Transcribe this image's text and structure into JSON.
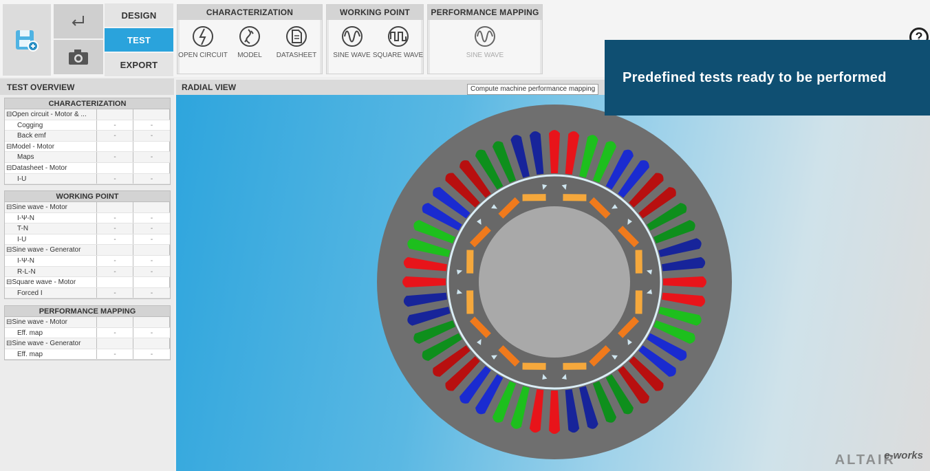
{
  "ribbon": {
    "nav": {
      "design": "DESIGN",
      "test": "TEST",
      "export": "EXPORT"
    },
    "groups": [
      {
        "title": "CHARACTERIZATION",
        "tools": [
          "OPEN CIRCUIT",
          "MODEL",
          "DATASHEET"
        ]
      },
      {
        "title": "WORKING POINT",
        "tools": [
          "SINE WAVE",
          "SQUARE WAVE"
        ]
      },
      {
        "title": "PERFORMANCE MAPPING",
        "tools": [
          "SINE WAVE"
        ]
      }
    ],
    "help": "?"
  },
  "banner": {
    "text": "Predefined tests ready to be performed"
  },
  "tooltip": {
    "text": "Compute machine performance mapping"
  },
  "left_panel": {
    "title": "TEST OVERVIEW",
    "sections": [
      {
        "title": "CHARACTERIZATION",
        "rows": [
          {
            "label": "⊟Open circuit - Motor & ...",
            "a": "",
            "b": "",
            "type": "group"
          },
          {
            "label": "Cogging",
            "a": "-",
            "b": "-",
            "type": "sub"
          },
          {
            "label": "Back emf",
            "a": "-",
            "b": "-",
            "type": "sub"
          },
          {
            "label": "⊟Model - Motor",
            "a": "",
            "b": "",
            "type": "group"
          },
          {
            "label": "Maps",
            "a": "-",
            "b": "-",
            "type": "sub"
          },
          {
            "label": "⊟Datasheet - Motor",
            "a": "",
            "b": "",
            "type": "group"
          },
          {
            "label": "I-U",
            "a": "-",
            "b": "-",
            "type": "sub"
          }
        ]
      },
      {
        "title": "WORKING POINT",
        "rows": [
          {
            "label": "⊟Sine wave - Motor",
            "a": "",
            "b": "",
            "type": "group"
          },
          {
            "label": "I-Ψ-N",
            "a": "-",
            "b": "-",
            "type": "sub"
          },
          {
            "label": "T-N",
            "a": "-",
            "b": "-",
            "type": "sub"
          },
          {
            "label": "I-U",
            "a": "-",
            "b": "-",
            "type": "sub"
          },
          {
            "label": "⊟Sine wave - Generator",
            "a": "",
            "b": "",
            "type": "group"
          },
          {
            "label": "I-Ψ-N",
            "a": "-",
            "b": "-",
            "type": "sub"
          },
          {
            "label": "R-L-N",
            "a": "-",
            "b": "-",
            "type": "sub"
          },
          {
            "label": "⊟Square wave - Motor",
            "a": "",
            "b": "",
            "type": "group"
          },
          {
            "label": "Forced I",
            "a": "-",
            "b": "-",
            "type": "sub"
          }
        ]
      },
      {
        "title": "PERFORMANCE MAPPING",
        "rows": [
          {
            "label": "⊟Sine wave - Motor",
            "a": "",
            "b": "",
            "type": "group"
          },
          {
            "label": "Eff. map",
            "a": "-",
            "b": "-",
            "type": "sub"
          },
          {
            "label": "⊟Sine wave - Generator",
            "a": "",
            "b": "",
            "type": "group"
          },
          {
            "label": "Eff. map",
            "a": "-",
            "b": "-",
            "type": "sub"
          }
        ]
      }
    ]
  },
  "view": {
    "title": "RADIAL VIEW",
    "watermark": "ALTAIR",
    "watermark2": "e-works",
    "coil_colors": [
      "#e8141a",
      "#1dbf1d",
      "#1a2bd0",
      "#b80f0f",
      "#0e8f1c",
      "#17249a"
    ],
    "magnet_colors": [
      "#f5a83c",
      "#f07a1c"
    ],
    "stator_color": "#6f6f6f",
    "rotor_color": "#a9a9a9"
  }
}
